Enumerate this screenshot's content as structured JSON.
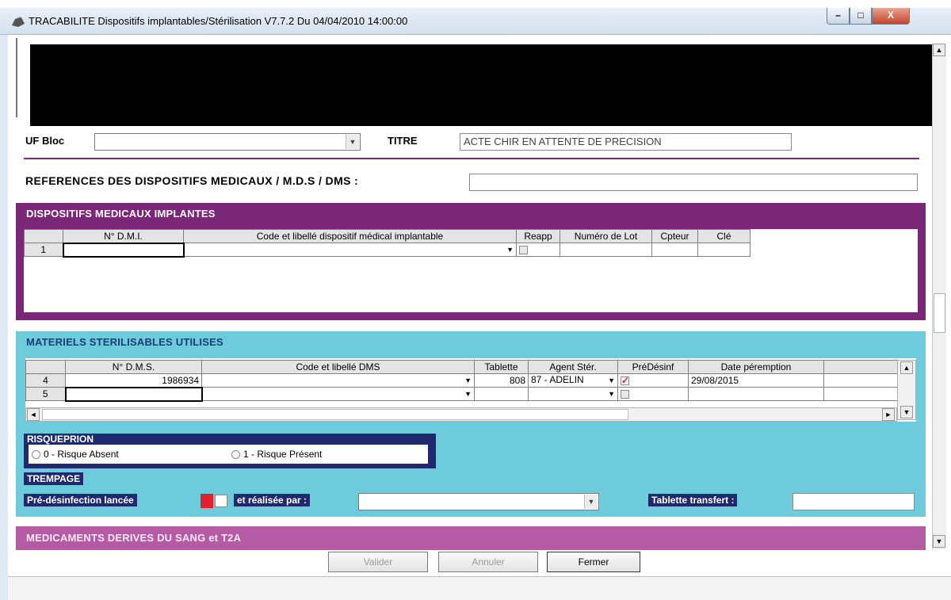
{
  "window": {
    "title": "TRACABILITE Dispositifs implantables/Stérilisation  V7.7.2 Du 04/04/2010 14:00:00",
    "minimize_glyph": "–",
    "maximize_glyph": "□",
    "close_glyph": "X"
  },
  "form": {
    "uf_bloc_label": "UF Bloc",
    "uf_bloc_value": "",
    "titre_label": "TITRE",
    "titre_value": "ACTE CHIR EN ATTENTE DE PRECISION",
    "references_label": "REFERENCES  DES  DISPOSITIFS MEDICAUX / M.D.S / DMS :",
    "references_value": ""
  },
  "dmi": {
    "title": "DISPOSITIFS MEDICAUX IMPLANTES",
    "columns": [
      "N° D.M.I.",
      "Code et libellé dispositif médical implantable",
      "Reapp",
      "Numéro de Lot",
      "Cpteur",
      "Clé"
    ],
    "rows": [
      {
        "num": "1",
        "ndmi": "",
        "code": "",
        "reapp": false,
        "lot": "",
        "cpteur": "",
        "cle": ""
      }
    ]
  },
  "materiels": {
    "title": "MATERIELS STERILISABLES UTILISES",
    "columns": [
      "N° D.M.S.",
      "Code et libellé DMS",
      "Tablette",
      "Agent Stér.",
      "PréDésinf",
      "Date péremption"
    ],
    "rows": [
      {
        "num": "4",
        "ndms": "1986934",
        "code": "",
        "tablette": "808",
        "agent": "87 - ADELIN",
        "predesinf": true,
        "date": "29/08/2015"
      },
      {
        "num": "5",
        "ndms": "",
        "code": "",
        "tablette": "",
        "agent": "",
        "predesinf": false,
        "date": ""
      }
    ]
  },
  "risqueprion": {
    "title": "RISQUEPRION",
    "option_absent": "0 - Risque Absent",
    "option_present": "1 - Risque Présent"
  },
  "trempage": {
    "title": "TREMPAGE",
    "predesinfection_label": "Pré-désinfection lancée",
    "realisee_label": "et réalisée par :",
    "realisee_value": "",
    "tablette_transfert_label": "Tablette transfert :",
    "tablette_transfert_value": ""
  },
  "medicaments": {
    "title": "MEDICAMENTS DERIVES DU SANG et T2A"
  },
  "buttons": {
    "valider": "Valider",
    "annuler": "Annuler",
    "fermer": "Fermer"
  },
  "colors": {
    "dmi_section": "#7b2778",
    "mat_section": "#6dcbdb",
    "med_section": "#b55aa5",
    "risque_box": "#1f2a6e"
  }
}
